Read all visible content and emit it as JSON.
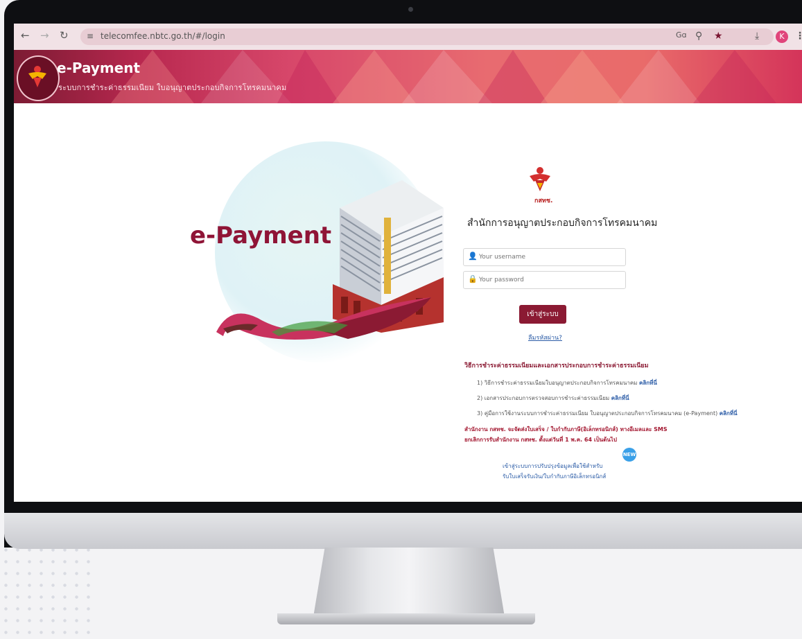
{
  "browser": {
    "back_icon": "arrow-left-icon",
    "forward_icon": "arrow-right-icon",
    "reload_icon": "reload-icon",
    "url": "telecomfee.nbtc.go.th/#/login",
    "right_icons": [
      "translate-icon",
      "zoom-icon",
      "star-icon",
      "download-icon",
      "profile-icon",
      "menu-icon"
    ],
    "translate_label": "Gɑ",
    "profile_initial": "K"
  },
  "header": {
    "title": "e-Payment",
    "subtitle": "ระบบการชำระค่าธรรมเนียม ใบอนุญาตประกอบกิจการโทรคมนาคม"
  },
  "hero": {
    "word": "e-Payment"
  },
  "login": {
    "emblem_caption": "กสทช.",
    "org_name": "สำนักการอนุญาตประกอบกิจการโทรคมนาคม",
    "username_placeholder": "Your username",
    "password_placeholder": "Your password",
    "login_button": "เข้าสู่ระบบ",
    "forgot_link": "ลืมรหัสผ่าน?"
  },
  "info": {
    "heading": "วิธีการชำระค่าธรรมเนียมและเอกสารประกอบการชำระค่าธรรมเนียม",
    "items": [
      {
        "text": "1) วิธีการชำระค่าธรรมเนียมใบอนุญาตประกอบกิจการโทรคมนาคม",
        "link": "คลิกที่นี่"
      },
      {
        "text": "2) เอกสารประกอบการตรวจสอบการชำระค่าธรรมเนียม",
        "link": "คลิกที่นี่"
      },
      {
        "text": "3) คู่มือการใช้งานระบบการชำระค่าธรรมเนียม ใบอนุญาตประกอบกิจการโทรคมนาคม (e-Payment)",
        "link": "คลิกที่นี่"
      }
    ],
    "notice_line1": "สำนักงาน กสทช. จะจัดส่งใบเสร็จ / ใบกำกับภาษี(อิเล็กทรอนิกส์) ทางอีเมลและ SMS",
    "notice_line2": "ยกเลิกการรับสำนักงาน กสทช. ตั้งแต่วันที่ 1 พ.ค. 64 เป็นต้นไป",
    "banner_line1": "เข้าสู่ระบบการปรับปรุงข้อมูลเพื่อใช้สำหรับ",
    "banner_line2": "รับใบเสร็จรับเงิน/ใบกำกับภาษีอิเล็กทรอนิกส์",
    "new_badge": "NEW"
  },
  "colors": {
    "brand": "#8b1a33",
    "header_pink": "#e86b70",
    "link": "#2a5ba6"
  }
}
